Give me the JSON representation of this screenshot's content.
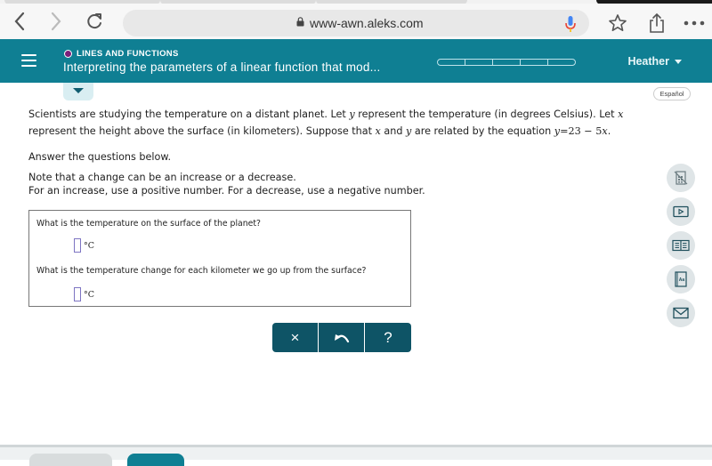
{
  "browser": {
    "url": "www-awn.aleks.com",
    "icons": {
      "back": "chevron-left-icon",
      "forward": "chevron-right-icon",
      "reload": "reload-icon",
      "lock": "lock-icon",
      "mic": "microphone-icon",
      "bookmark": "star-icon",
      "share": "share-icon",
      "more": "more-icon"
    }
  },
  "header": {
    "topic": "LINES AND FUNCTIONS",
    "title": "Interpreting the parameters of a linear function that mod...",
    "progress_segments": 5,
    "progress_filled": 0,
    "user": "Heather",
    "accent_color": "#0f7f93",
    "topic_dot_color": "#7a1f7a"
  },
  "language_button": "Español",
  "problem": {
    "line1_a": "Scientists are studying the temperature on a distant planet. Let ",
    "var_y": "y",
    "line1_b": " represent the temperature (in degrees Celsius). Let ",
    "var_x": "x",
    "line2_a": "represent the height above the surface (in kilometers). Suppose that ",
    "line2_b": " and ",
    "line2_c": " are related by the equation ",
    "equation_lhs": "y",
    "equation_eq": "=",
    "equation_num": "23",
    "equation_minus": " − ",
    "equation_coef": "5",
    "equation_var": "x",
    "equation_end": ".",
    "instruction": "Answer the questions below.",
    "note1": "Note that a change can be an increase or a decrease.",
    "note2": "For an increase, use a positive number. For a decrease, use a negative number."
  },
  "questions": [
    {
      "text": "What is the temperature on the surface of the planet?",
      "value": "",
      "unit": "°C"
    },
    {
      "text": "What is the temperature change for each kilometer we go up from the surface?",
      "value": "",
      "unit": "°C"
    }
  ],
  "actions": {
    "clear": "×",
    "undo": "↶",
    "help": "?"
  },
  "side_tools": [
    "calculator-disabled-icon",
    "video-icon",
    "textbook-icon",
    "dictionary-icon",
    "message-icon"
  ]
}
